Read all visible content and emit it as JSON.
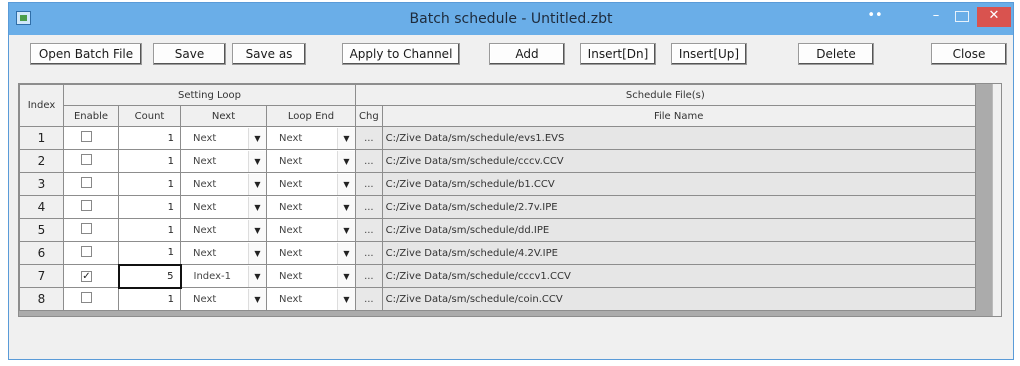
{
  "window": {
    "title": "Batch schedule - Untitled.zbt",
    "extra_btn": "••",
    "min_btn": "–",
    "close_btn": "✕"
  },
  "toolbar": {
    "open": "Open Batch File",
    "save": "Save",
    "save_as": "Save as",
    "apply": "Apply to Channel",
    "add": "Add",
    "insert_dn": "Insert[Dn]",
    "insert_up": "Insert[Up]",
    "delete": "Delete",
    "close": "Close"
  },
  "grid": {
    "headers": {
      "index": "Index",
      "setting_loop": "Setting Loop",
      "schedule_files": "Schedule File(s)",
      "enable": "Enable",
      "count": "Count",
      "next": "Next",
      "loop_end": "Loop End",
      "chg": "Chg",
      "file_name": "File Name"
    },
    "rows": [
      {
        "index": "1",
        "enabled": "",
        "count": "1",
        "next": "Next",
        "loop_end": "Next",
        "chg": "...",
        "file": "C:/Zive Data/sm/schedule/evs1.EVS"
      },
      {
        "index": "2",
        "enabled": "",
        "count": "1",
        "next": "Next",
        "loop_end": "Next",
        "chg": "...",
        "file": "C:/Zive Data/sm/schedule/cccv.CCV"
      },
      {
        "index": "3",
        "enabled": "",
        "count": "1",
        "next": "Next",
        "loop_end": "Next",
        "chg": "...",
        "file": "C:/Zive Data/sm/schedule/b1.CCV"
      },
      {
        "index": "4",
        "enabled": "",
        "count": "1",
        "next": "Next",
        "loop_end": "Next",
        "chg": "...",
        "file": "C:/Zive Data/sm/schedule/2.7v.IPE"
      },
      {
        "index": "5",
        "enabled": "",
        "count": "1",
        "next": "Next",
        "loop_end": "Next",
        "chg": "...",
        "file": "C:/Zive Data/sm/schedule/dd.IPE"
      },
      {
        "index": "6",
        "enabled": "",
        "count": "1",
        "next": "Next",
        "loop_end": "Next",
        "chg": "...",
        "file": "C:/Zive Data/sm/schedule/4.2V.IPE"
      },
      {
        "index": "7",
        "enabled": "✓",
        "count": "5",
        "next": "Index-1",
        "loop_end": "Next",
        "chg": "...",
        "file": "C:/Zive Data/sm/schedule/cccv1.CCV"
      },
      {
        "index": "8",
        "enabled": "",
        "count": "1",
        "next": "Next",
        "loop_end": "Next",
        "chg": "...",
        "file": "C:/Zive Data/sm/schedule/coin.CCV"
      }
    ]
  }
}
